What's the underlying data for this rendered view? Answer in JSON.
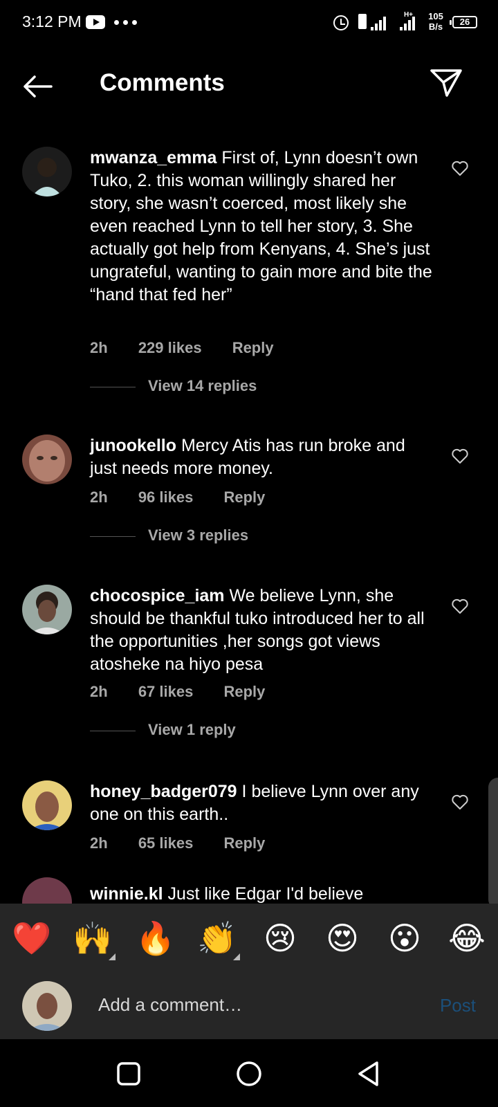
{
  "status_bar": {
    "time": "3:12 PM",
    "network_type": "H+",
    "net_speed_value": "105",
    "net_speed_unit": "B/s",
    "battery": "26"
  },
  "header": {
    "title": "Comments",
    "back_icon": "arrow-left-icon",
    "share_icon": "send-icon"
  },
  "comments": [
    {
      "username": "mwanza_emma",
      "text": "First of, Lynn doesn’t own Tuko, 2. this woman willingly shared her story, she wasn’t coerced, most likely she even reached Lynn to tell her story, 3. She actually got help from Kenyans, 4. She’s just ungrateful, wanting to gain more and bite the “hand that fed her”",
      "time": "2h",
      "likes": "229 likes",
      "reply": "Reply",
      "view_replies": "View 14 replies"
    },
    {
      "username": "junookello",
      "text": "Mercy Atis has run broke and just needs more money.",
      "time": "2h",
      "likes": "96 likes",
      "reply": "Reply",
      "view_replies": "View 3 replies"
    },
    {
      "username": "chocospice_iam",
      "text": "We believe Lynn, she should be thankful tuko introduced her to all the opportunities ,her songs got views atosheke na hiyo pesa",
      "time": "2h",
      "likes": "67 likes",
      "reply": "Reply",
      "view_replies": "View 1 reply"
    },
    {
      "username": "honey_badger079",
      "text": "I believe Lynn over any one on this earth..",
      "time": "2h",
      "likes": "65 likes",
      "reply": "Reply"
    },
    {
      "username": "winnie.kl",
      "text": "Just like Edgar I'd believe"
    }
  ],
  "emoji_bar": [
    "❤️",
    "🙌",
    "🔥",
    "👏",
    "😢",
    "😍",
    "😮",
    "😂"
  ],
  "composer": {
    "placeholder": "Add a comment…",
    "post_label": "Post"
  }
}
